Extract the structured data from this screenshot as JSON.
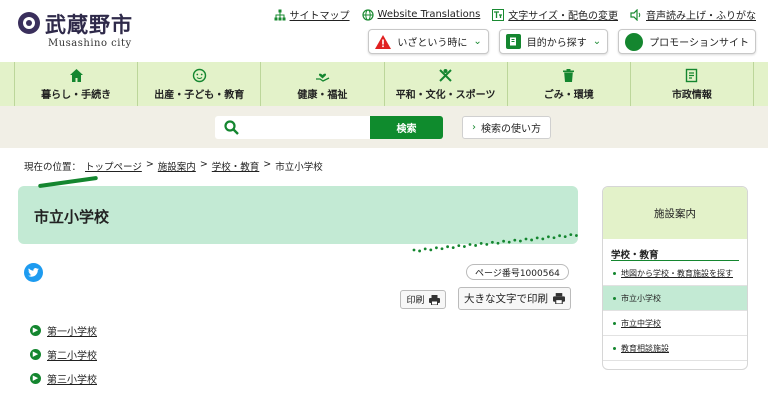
{
  "header": {
    "logo_title": "武蔵野市",
    "logo_sub": "Musashino city",
    "util_links": [
      {
        "label": "サイトマップ",
        "icon": "sitemap-icon"
      },
      {
        "label": "Website Translations",
        "icon": "globe-icon"
      },
      {
        "label": "文字サイズ・配色の変更",
        "icon": "font-size-icon"
      },
      {
        "label": "音声読み上げ・ふりがな",
        "icon": "speaker-icon"
      }
    ],
    "quick_buttons": [
      {
        "label": "いざという時に",
        "icon": "warning-icon"
      },
      {
        "label": "目的から探す",
        "icon": "book-icon"
      },
      {
        "label": "プロモーションサイト",
        "icon": "promotion-icon"
      }
    ]
  },
  "gnav": [
    {
      "label": "暮らし・手続き",
      "icon": "home-icon"
    },
    {
      "label": "出産・子ども・教育",
      "icon": "child-icon"
    },
    {
      "label": "健康・福祉",
      "icon": "heart-hand-icon"
    },
    {
      "label": "平和・文化・スポーツ",
      "icon": "culture-icon"
    },
    {
      "label": "ごみ・環境",
      "icon": "trash-icon"
    },
    {
      "label": "市政情報",
      "icon": "document-icon"
    }
  ],
  "search": {
    "placeholder": "",
    "button": "検索",
    "help": "検索の使い方"
  },
  "breadcrumb": {
    "prefix": "現在の位置：",
    "items": [
      "トップページ",
      "施設案内",
      "学校・教育"
    ],
    "current": "市立小学校",
    "separator": ">"
  },
  "page": {
    "title": "市立小学校",
    "page_number": "ページ番号1000564",
    "print": "印刷",
    "print_large": "大きな文字で印刷",
    "schools": [
      "第一小学校",
      "第二小学校",
      "第三小学校"
    ]
  },
  "sidebar": {
    "heading": "施設案内",
    "category": "学校・教育",
    "items": [
      {
        "label": "地図から学校・教育施設を探す",
        "active": false
      },
      {
        "label": "市立小学校",
        "active": true
      },
      {
        "label": "市立中学校",
        "active": false
      },
      {
        "label": "教育相談施設",
        "active": false
      }
    ]
  },
  "colors": {
    "brand_green": "#14862f",
    "nav_bg": "#e3f2c9",
    "title_bg": "#c3ead4",
    "search_band": "#f1efe6",
    "twitter": "#1d9bf0"
  }
}
